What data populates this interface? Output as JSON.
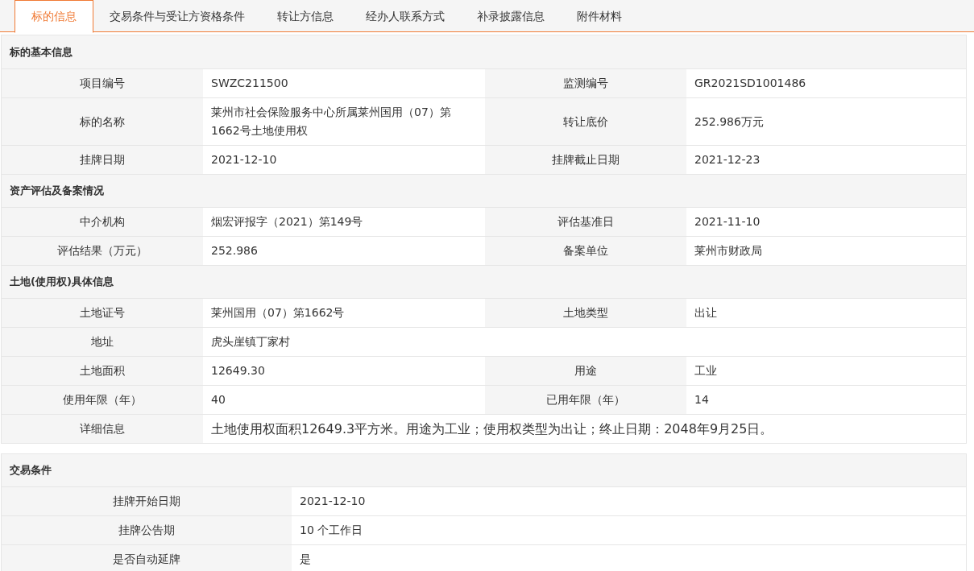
{
  "tabs": [
    {
      "label": "标的信息",
      "selected": true
    },
    {
      "label": "交易条件与受让方资格条件",
      "selected": false
    },
    {
      "label": "转让方信息",
      "selected": false
    },
    {
      "label": "经办人联系方式",
      "selected": false
    },
    {
      "label": "补录披露信息",
      "selected": false
    },
    {
      "label": "附件材料",
      "selected": false
    }
  ],
  "panels": [
    {
      "kind": "four",
      "sections": [
        {
          "title": "标的基本信息",
          "rows": [
            {
              "kind": "pair",
              "cells": [
                {
                  "label": "项目编号",
                  "value": "SWZC211500"
                },
                {
                  "label": "监测编号",
                  "value": "GR2021SD1001486"
                }
              ]
            },
            {
              "kind": "pair",
              "cells": [
                {
                  "label": "标的名称",
                  "value": "莱州市社会保险服务中心所属莱州国用（07）第1662号土地使用权"
                },
                {
                  "label": "转让底价",
                  "value": "252.986万元"
                }
              ]
            },
            {
              "kind": "pair",
              "cells": [
                {
                  "label": "挂牌日期",
                  "value": "2021-12-10"
                },
                {
                  "label": "挂牌截止日期",
                  "value": "2021-12-23"
                }
              ]
            }
          ]
        },
        {
          "title": "资产评估及备案情况",
          "rows": [
            {
              "kind": "pair",
              "cells": [
                {
                  "label": "中介机构",
                  "value": "烟宏评报字（2021）第149号"
                },
                {
                  "label": "评估基准日",
                  "value": "2021-11-10"
                }
              ]
            },
            {
              "kind": "pair",
              "cells": [
                {
                  "label": "评估结果（万元）",
                  "value": "252.986"
                },
                {
                  "label": "备案单位",
                  "value": "莱州市财政局"
                }
              ]
            }
          ]
        },
        {
          "title": "土地(使用权)具体信息",
          "rows": [
            {
              "kind": "pair",
              "cells": [
                {
                  "label": "土地证号",
                  "value": "莱州国用（07）第1662号"
                },
                {
                  "label": "土地类型",
                  "value": "出让"
                }
              ]
            },
            {
              "kind": "pair",
              "cells": [
                {
                  "label": "地址",
                  "value": "虎头崖镇丁家村"
                }
              ]
            },
            {
              "kind": "pair",
              "cells": [
                {
                  "label": "土地面积",
                  "value": "12649.30"
                },
                {
                  "label": "用途",
                  "value": "工业"
                }
              ]
            },
            {
              "kind": "pair",
              "cells": [
                {
                  "label": "使用年限（年）",
                  "value": "40"
                },
                {
                  "label": "已用年限（年）",
                  "value": "14"
                }
              ]
            },
            {
              "kind": "detail",
              "cells": [
                {
                  "label": "详细信息",
                  "value": "土地使用权面积12649.3平方米。用途为工业；使用权类型为出让；终止日期：2048年9月25日。"
                }
              ]
            }
          ]
        }
      ]
    },
    {
      "kind": "two",
      "sections": [
        {
          "title": "交易条件",
          "rows": [
            {
              "kind": "pair",
              "cells": [
                {
                  "label": "挂牌开始日期",
                  "value": "2021-12-10"
                }
              ]
            },
            {
              "kind": "pair",
              "cells": [
                {
                  "label": "挂牌公告期",
                  "value": "10 个工作日"
                }
              ]
            },
            {
              "kind": "pair",
              "cells": [
                {
                  "label": "是否自动延牌",
                  "value": "是"
                }
              ]
            }
          ]
        }
      ]
    }
  ]
}
